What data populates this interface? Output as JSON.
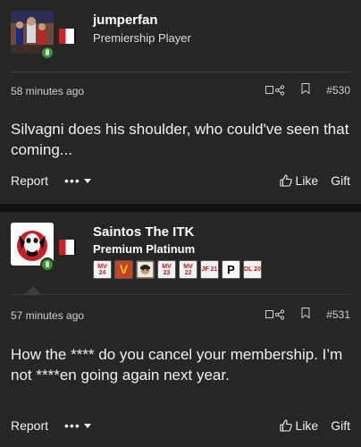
{
  "posts": [
    {
      "username": "jumperfan",
      "rank": "Premiership Player",
      "timestamp": "58 minutes ago",
      "post_number": "#530",
      "body": "Silvagni does his shoulder, who could've seen that coming...",
      "report_label": "Report",
      "more_label": "•••",
      "like_label": "Like",
      "gift_label": "Gift"
    },
    {
      "username": "Saintos The ITK",
      "rank": "Premium Platinum",
      "timestamp": "57 minutes ago",
      "post_number": "#531",
      "body": "How the **** do you cancel your membership. I’m not ****en going again next year.",
      "report_label": "Report",
      "more_label": "•••",
      "like_label": "Like",
      "gift_label": "Gift",
      "badges": [
        {
          "text": "MV 24",
          "kind": "text"
        },
        {
          "text": "V",
          "kind": "v"
        },
        {
          "text": "",
          "kind": "face"
        },
        {
          "text": "MV 23",
          "kind": "text"
        },
        {
          "text": "MV 22",
          "kind": "text"
        },
        {
          "text": "JF 21",
          "kind": "text"
        },
        {
          "text": "P",
          "kind": "p"
        },
        {
          "text": "DL 20",
          "kind": "text"
        }
      ]
    }
  ],
  "colors": {
    "background": "#111111",
    "card": "#262626",
    "online": "#3f8e3a",
    "flag_red": "#c9262b"
  }
}
